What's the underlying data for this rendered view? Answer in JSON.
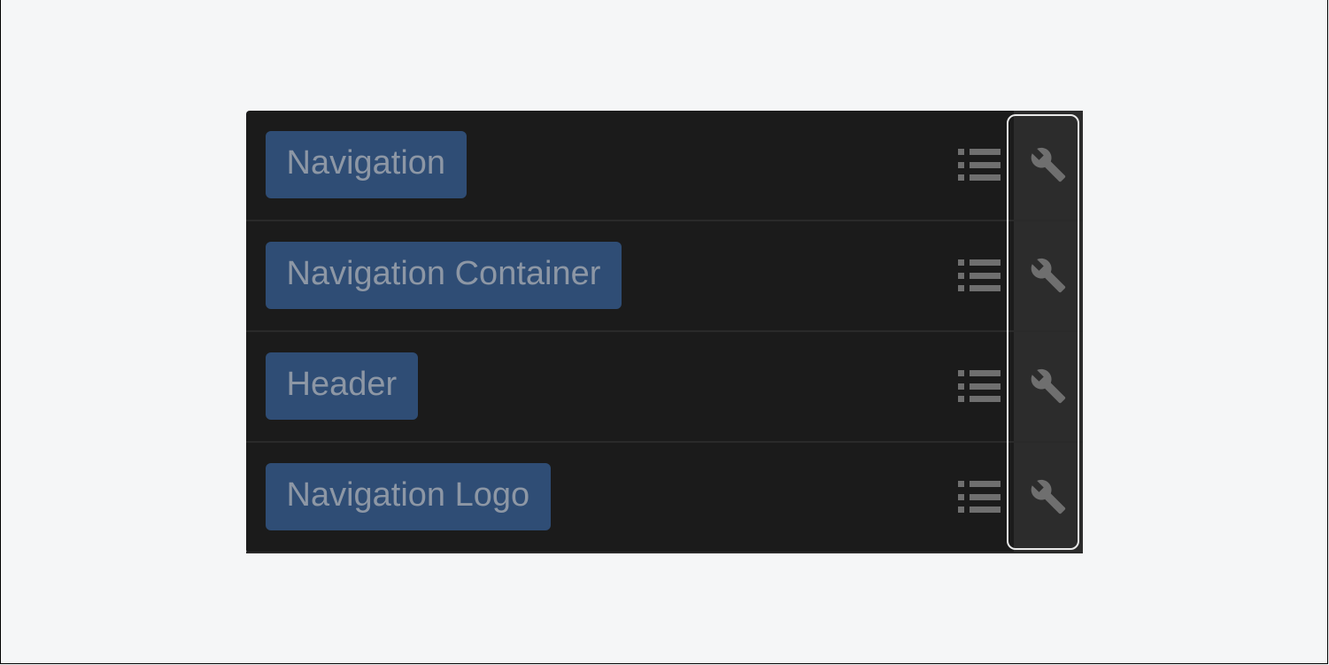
{
  "panel": {
    "rows": [
      {
        "label": "Navigation"
      },
      {
        "label": "Navigation Container"
      },
      {
        "label": "Header"
      },
      {
        "label": "Navigation Logo"
      }
    ]
  }
}
